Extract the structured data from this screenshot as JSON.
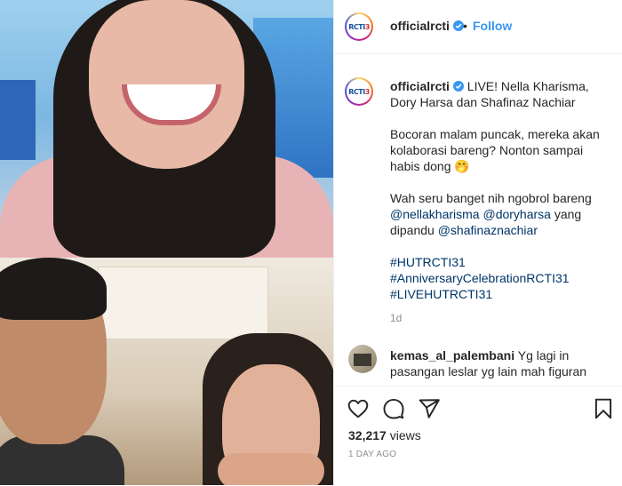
{
  "header": {
    "username": "officialrcti",
    "separator": "•",
    "follow_label": "Follow"
  },
  "brand": {
    "logo_text": "RCTI",
    "logo_number": "3",
    "verified_color": "#3897f0"
  },
  "caption": {
    "username": "officialrcti",
    "line1": "LIVE! Nella Kharisma, Dory Harsa dan Shafinaz Nachiar",
    "line2": "Bocoran malam puncak, mereka akan kolaborasi bareng? Nonton sampai habis dong 🤭",
    "line3_prefix": "Wah seru banget nih ngobrol bareng",
    "mention1": "@nellakharisma",
    "mention2": "@doryharsa",
    "line3_mid": "yang dipandu",
    "mention3": "@shafinaznachiar",
    "hashtag1": "#HUTRCTI31",
    "hashtag2": "#AnniversaryCelebrationRCTI31",
    "hashtag3": "#LIVEHUTRCTI31",
    "age": "1d"
  },
  "comment": {
    "username": "kemas_al_palembani",
    "text": "Yg lagi in pasangan leslar yg lain mah figuran"
  },
  "actions": {
    "icons": [
      "heart-icon",
      "comment-icon",
      "share-icon",
      "bookmark-icon"
    ]
  },
  "stats": {
    "views_count": "32,217",
    "views_label": "views",
    "time_label": "1 DAY AGO"
  }
}
